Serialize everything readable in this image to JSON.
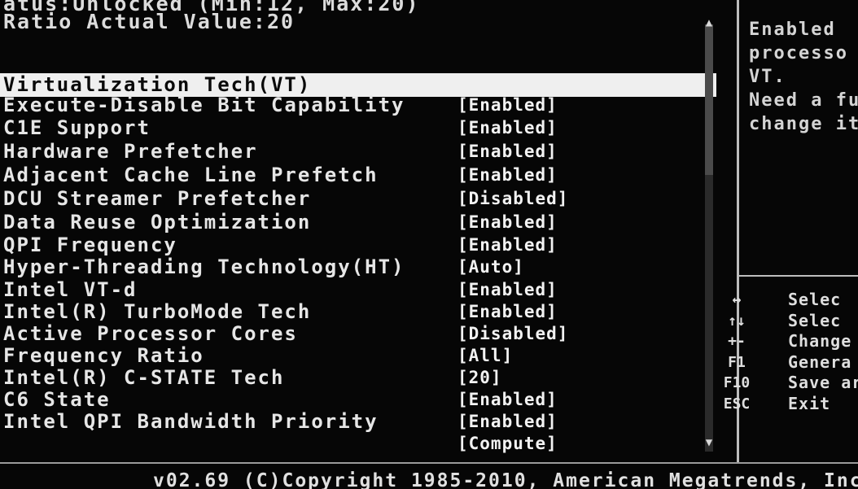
{
  "header": {
    "line1": "atus:Unlocked (Min:12, Max:20)",
    "line2": "Ratio Actual Value:20"
  },
  "settings": [
    {
      "label": "Virtualization Tech(VT)",
      "value": ""
    },
    {
      "label": "Execute-Disable Bit Capability",
      "value": "[Enabled]"
    },
    {
      "label": "C1E Support",
      "value": "[Enabled]"
    },
    {
      "label": "Hardware Prefetcher",
      "value": "[Enabled]"
    },
    {
      "label": "Adjacent Cache Line Prefetch",
      "value": "[Enabled]"
    },
    {
      "label": "DCU Streamer Prefetcher",
      "value": "[Disabled]"
    },
    {
      "label": "Data Reuse Optimization",
      "value": "[Enabled]"
    },
    {
      "label": "QPI Frequency",
      "value": "[Enabled]"
    },
    {
      "label": "Hyper-Threading Technology(HT)",
      "value": "[Auto]"
    },
    {
      "label": "Intel VT-d",
      "value": "[Enabled]"
    },
    {
      "label": "Intel(R) TurboMode Tech",
      "value": "[Enabled]"
    },
    {
      "label": "Active Processor Cores",
      "value": "[Disabled]"
    },
    {
      "label": "Frequency Ratio",
      "value": "[All]"
    },
    {
      "label": "Intel(R) C-STATE Tech",
      "value": "[20]"
    },
    {
      "label": "C6 State",
      "value": "[Enabled]"
    },
    {
      "label": "Intel QPI Bandwidth Priority",
      "value": "[Enabled]"
    },
    {
      "label": "",
      "value": "[Compute]"
    }
  ],
  "help_text": "Enabled\nprocesso\nVT.\nNeed a fu\nchange it",
  "keys": [
    {
      "key": "↔",
      "desc": "Selec"
    },
    {
      "key": "↑↓",
      "desc": "Selec"
    },
    {
      "key": "+-",
      "desc": "Change"
    },
    {
      "key": "F1",
      "desc": "Genera"
    },
    {
      "key": "F10",
      "desc": "Save ar"
    },
    {
      "key": "ESC",
      "desc": "Exit"
    }
  ],
  "scroll": {
    "up_arrow": "▲",
    "down_arrow": "▼"
  },
  "footer": "v02.69 (C)Copyright 1985-2010, American Megatrends, Inc.",
  "colors": {
    "background": "#060606",
    "selected_bar": "#efefef",
    "text": "#e6e6e6"
  }
}
